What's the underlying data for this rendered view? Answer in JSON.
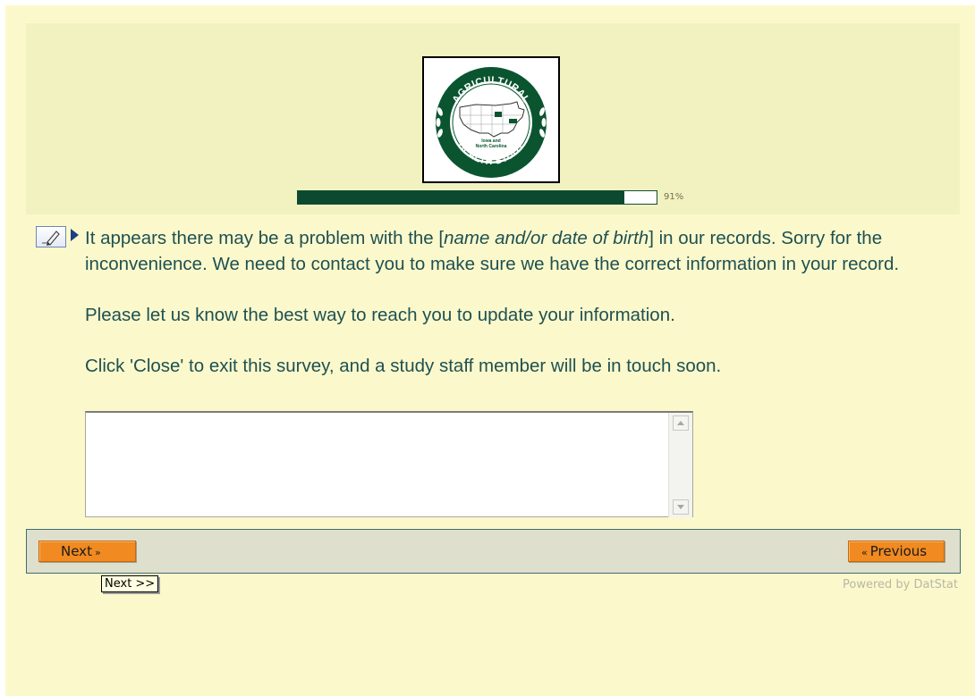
{
  "header": {
    "logo": {
      "ring_top_text": "AGRICULTURAL",
      "ring_bottom_text": "HEALTH STUDY",
      "map_caption_line1": "Iowa and",
      "map_caption_line2": "North Carolina",
      "ring_color": "#0a5530",
      "icon": "agricultural-health-study-logo"
    },
    "progress": {
      "fraction": 0.91,
      "label": "91%",
      "fill_color": "#0b4a30"
    }
  },
  "question": {
    "line1_before": "It appears there may be a problem with the [",
    "line1_emphasis": "name and/or date of birth",
    "line1_after": "] in our records.  Sorry for the inconvenience.  We need to contact you to make sure we have the correct information in your record.",
    "paragraph2": "Please let us know the best way to reach you to update your information.",
    "paragraph3": "Click 'Close' to exit this survey, and a study staff member will be in touch soon.",
    "answer_value": ""
  },
  "icons": {
    "edit": "pencil-edit-icon",
    "pointer": "triangle-pointer-icon"
  },
  "nav": {
    "next_label": "Next",
    "next_arrows": "»",
    "previous_label": "Previous",
    "previous_arrows": "«",
    "accent_color": "#f08a21"
  },
  "tooltip": {
    "text": "Next >>"
  },
  "footer": {
    "powered_by": "Powered by DatStat"
  }
}
